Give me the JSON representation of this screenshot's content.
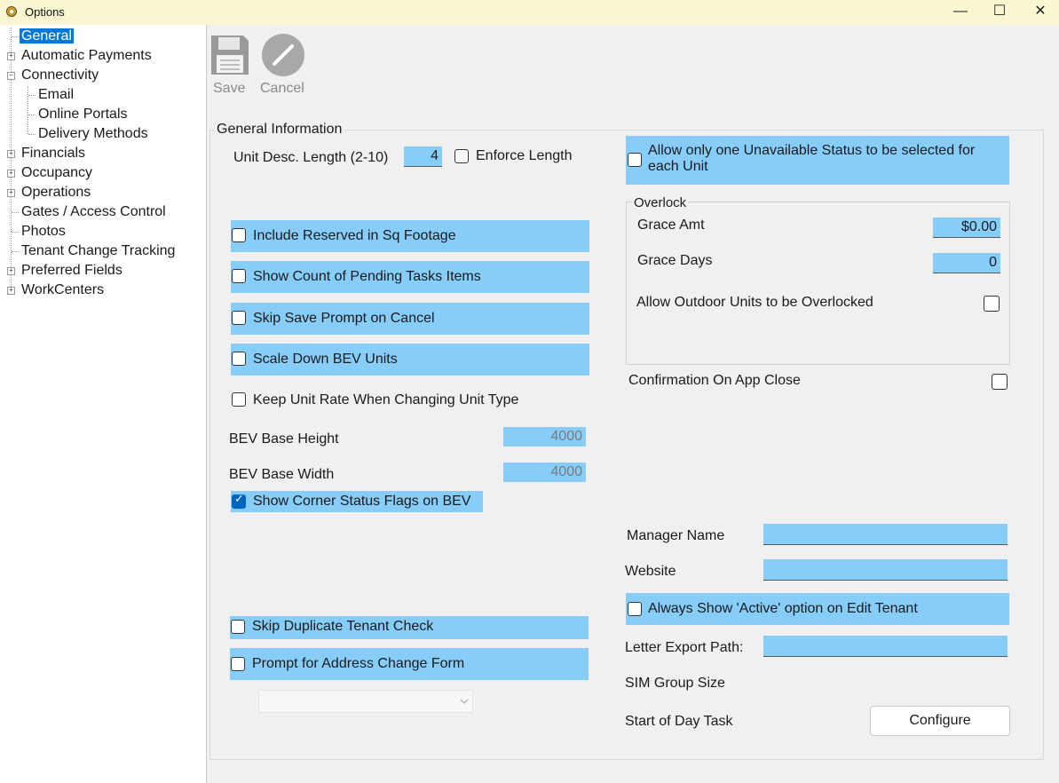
{
  "window": {
    "title": "Options",
    "minimize": "—",
    "maximize": "☐",
    "close": "✕"
  },
  "tree": {
    "items": [
      {
        "label": "General",
        "level": 0,
        "selected": true,
        "expandable": false
      },
      {
        "label": "Automatic Payments",
        "level": 0,
        "expandable": true
      },
      {
        "label": "Connectivity",
        "level": 0,
        "expandable": true,
        "expanded": true
      },
      {
        "label": "Email",
        "level": 1
      },
      {
        "label": "Online Portals",
        "level": 1
      },
      {
        "label": "Delivery Methods",
        "level": 1
      },
      {
        "label": "Financials",
        "level": 0,
        "expandable": true
      },
      {
        "label": "Occupancy",
        "level": 0,
        "expandable": true
      },
      {
        "label": "Operations",
        "level": 0,
        "expandable": true
      },
      {
        "label": "Gates / Access Control",
        "level": 0
      },
      {
        "label": "Photos",
        "level": 0
      },
      {
        "label": "Tenant Change Tracking",
        "level": 0
      },
      {
        "label": "Preferred Fields",
        "level": 0,
        "expandable": true
      },
      {
        "label": "WorkCenters",
        "level": 0,
        "expandable": true
      }
    ]
  },
  "toolbar": {
    "save_label": "Save",
    "cancel_label": "Cancel"
  },
  "general": {
    "group_title": "General Information",
    "unit_desc_length_label": "Unit Desc. Length (2-10)",
    "unit_desc_length_value": "4",
    "enforce_length_label": "Enforce Length",
    "include_reserved_label": "Include Reserved in Sq Footage",
    "show_count_pending_label": "Show Count of Pending Tasks Items",
    "skip_save_prompt_label": "Skip Save Prompt on Cancel",
    "scale_down_bev_label": "Scale Down BEV Units",
    "keep_unit_rate_label": "Keep Unit Rate When Changing Unit Type",
    "bev_base_height_label": "BEV Base Height",
    "bev_base_height_value": "4000",
    "bev_base_width_label": "BEV Base Width",
    "bev_base_width_value": "4000",
    "show_corner_flags_label": "Show Corner Status Flags on BEV",
    "show_corner_flags_checked": true,
    "skip_duplicate_tenant_label": "Skip Duplicate Tenant Check",
    "prompt_address_change_label": "Prompt for Address Change Form",
    "allow_one_unavailable_label": "Allow only one Unavailable Status to be selected for each Unit",
    "overlock": {
      "title": "Overlock",
      "grace_amt_label": "Grace Amt",
      "grace_amt_value": "$0.00",
      "grace_days_label": "Grace Days",
      "grace_days_value": "0",
      "allow_outdoor_label": "Allow Outdoor Units to be Overlocked"
    },
    "confirmation_on_close_label": "Confirmation On App Close",
    "manager_name_label": "Manager Name",
    "manager_name_value": "",
    "website_label": "Website",
    "website_value": "",
    "always_show_active_label": "Always Show 'Active' option on Edit Tenant",
    "letter_export_path_label": "Letter Export Path:",
    "letter_export_path_value": "",
    "sim_group_size_label": "SIM Group Size",
    "start_of_day_task_label": "Start of Day Task",
    "configure_label": "Configure"
  },
  "colors": {
    "highlight": "#87cdfa",
    "selection": "#0078d7",
    "titlebar": "#f9f6d2"
  }
}
